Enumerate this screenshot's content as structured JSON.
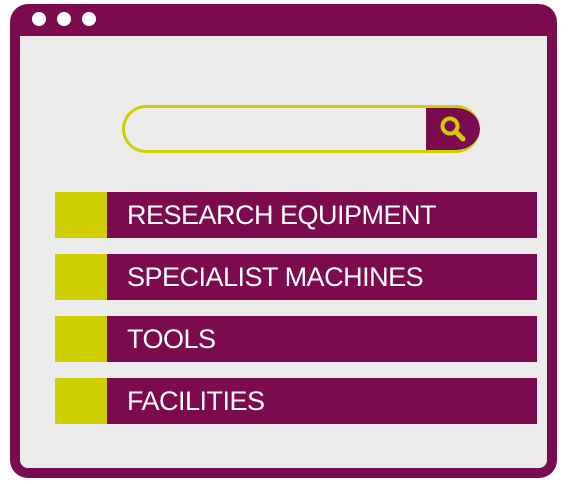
{
  "colors": {
    "frame": "#7b0a4f",
    "accent": "#cfcf00",
    "background": "#ececec",
    "text": "#ffffff"
  },
  "window": {
    "controls": [
      "dot",
      "dot",
      "dot"
    ]
  },
  "search": {
    "value": "",
    "placeholder": "",
    "button_icon": "search-icon"
  },
  "menu": {
    "items": [
      {
        "label": "RESEARCH EQUIPMENT"
      },
      {
        "label": "SPECIALIST MACHINES"
      },
      {
        "label": "TOOLS"
      },
      {
        "label": "FACILITIES"
      }
    ]
  }
}
